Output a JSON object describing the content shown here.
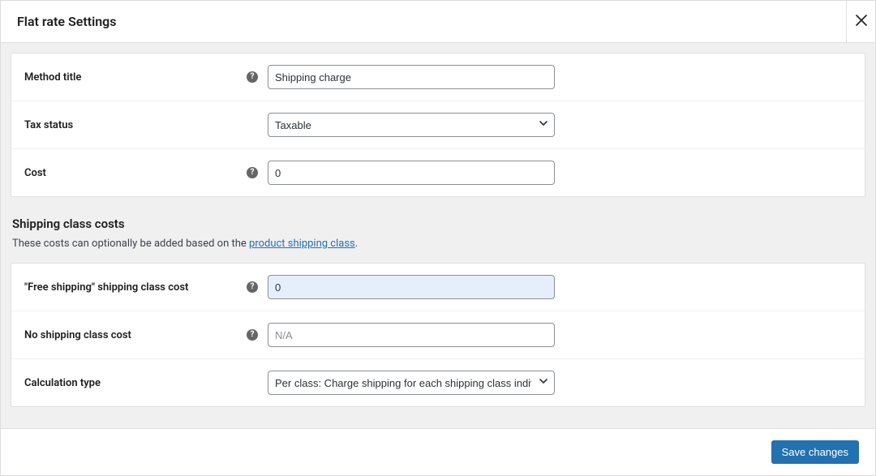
{
  "modal": {
    "title": "Flat rate Settings"
  },
  "form": {
    "method_title": {
      "label": "Method title",
      "value": "Shipping charge"
    },
    "tax_status": {
      "label": "Tax status",
      "selected": "Taxable"
    },
    "cost": {
      "label": "Cost",
      "value": "0"
    }
  },
  "section": {
    "heading": "Shipping class costs",
    "description_prefix": "These costs can optionally be added based on the ",
    "description_link": "product shipping class",
    "description_suffix": "."
  },
  "class_costs": {
    "free_shipping": {
      "label": "\"Free shipping\" shipping class cost",
      "value": "0"
    },
    "no_class": {
      "label": "No shipping class cost",
      "placeholder": "N/A"
    },
    "calc_type": {
      "label": "Calculation type",
      "selected": "Per class: Charge shipping for each shipping class individually"
    }
  },
  "footer": {
    "save_label": "Save changes"
  }
}
